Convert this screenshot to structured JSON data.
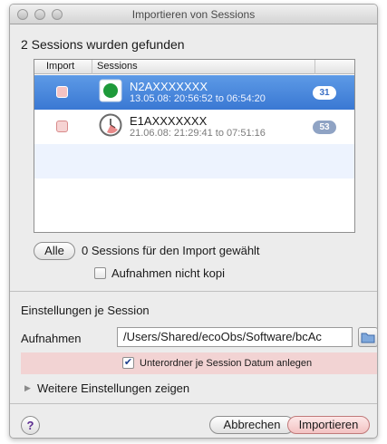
{
  "window": {
    "title": "Importieren von Sessions"
  },
  "found_label": "2 Sessions wurden gefunden",
  "table": {
    "headers": [
      "Import",
      "Sessions"
    ],
    "rows": [
      {
        "name": "N2AXXXXXXX",
        "date": "13.05.08: 20:56:52 to 06:54:20",
        "count": "31",
        "selected": true,
        "icon": "green-record-icon"
      },
      {
        "name": "E1AXXXXXXX",
        "date": "21.06.08: 21:29:41 to 07:51:16",
        "count": "53",
        "selected": false,
        "icon": "clock-icon"
      }
    ]
  },
  "all_button": "Alle",
  "count_label": "0 Sessions für den Import gewählt",
  "copy_checkbox_label": "Aufnahmen nicht kopi",
  "section_title": "Einstellungen je Session",
  "aufnahmen_label": "Aufnahmen",
  "path_value": "/Users/Shared/ecoObs/Software/bcAc",
  "subfolder_label": "Unterordner je Session Datum anlegen",
  "more_settings_label": "Weitere Einstellungen zeigen",
  "help_label": "?",
  "cancel_label": "Abbrechen",
  "import_label": "Importieren",
  "colors": {
    "selection": "#3a78d3",
    "highlight_band": "#f2d3d3",
    "badge": "#8fa3c4"
  }
}
